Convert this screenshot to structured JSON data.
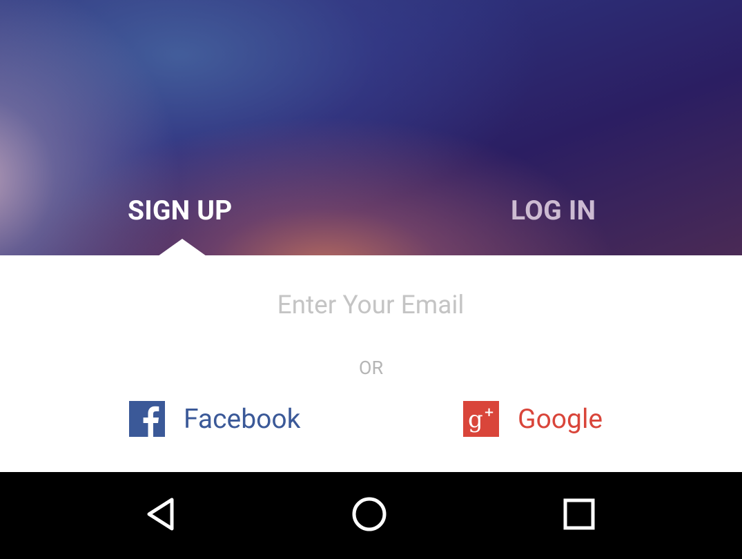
{
  "tabs": {
    "signup_label": "SIGN UP",
    "login_label": "LOG IN",
    "active": "signup"
  },
  "email": {
    "value": "",
    "placeholder": "Enter Your Email"
  },
  "divider_text": "OR",
  "social": {
    "facebook": {
      "label": "Facebook",
      "icon": "facebook-icon",
      "color": "#3b5998"
    },
    "google": {
      "label": "Google",
      "icon": "google-plus-icon",
      "color": "#d9453a"
    }
  },
  "navbar": {
    "back_icon": "back-triangle-icon",
    "home_icon": "home-circle-icon",
    "recents_icon": "recents-square-icon"
  },
  "colors": {
    "background": "#ffffff",
    "navbar": "#000000",
    "placeholder": "#c4c4c4"
  }
}
